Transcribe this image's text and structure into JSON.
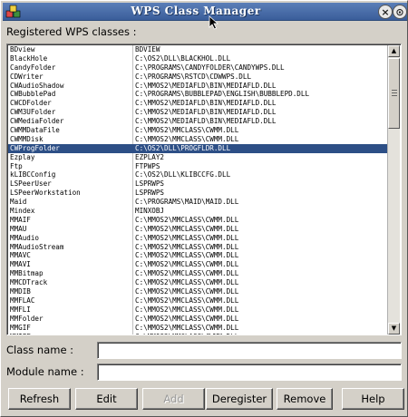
{
  "window": {
    "title": "WPS Class Manager"
  },
  "titlebar": {
    "close_glyph": "×",
    "max_glyph": "⊙"
  },
  "list": {
    "label": "Registered WPS classes :",
    "rows": [
      [
        "BDview",
        "BDVIEW"
      ],
      [
        "BlackHole",
        "C:\\OS2\\DLL\\BLACKHOL.DLL"
      ],
      [
        "CandyFolder",
        "C:\\PROGRAMS\\CANDYFOLDER\\CANDYWPS.DLL"
      ],
      [
        "CDWriter",
        "C:\\PROGRAMS\\RSTCD\\CDWWPS.DLL"
      ],
      [
        "CWAudioShadow",
        "C:\\MMOS2\\MEDIAFLD\\BIN\\MEDIAFLD.DLL"
      ],
      [
        "CWBubblePad",
        "C:\\PROGRAMS\\BUBBLEPAD\\ENGLISH\\BUBBLEPD.DLL"
      ],
      [
        "CWCDFolder",
        "C:\\MMOS2\\MEDIAFLD\\BIN\\MEDIAFLD.DLL"
      ],
      [
        "CWM3UFolder",
        "C:\\MMOS2\\MEDIAFLD\\BIN\\MEDIAFLD.DLL"
      ],
      [
        "CWMediaFolder",
        "C:\\MMOS2\\MEDIAFLD\\BIN\\MEDIAFLD.DLL"
      ],
      [
        "CWMMDataFile",
        "C:\\MMOS2\\MMCLASS\\CWMM.DLL"
      ],
      [
        "CWMMDisk",
        "C:\\MMOS2\\MMCLASS\\CWMM.DLL"
      ],
      [
        "CWProgFolder",
        "C:\\OS2\\DLL\\PROGFLDR.DLL"
      ],
      [
        "Ezplay",
        "EZPLAY2"
      ],
      [
        "Ftp",
        "FTPWPS"
      ],
      [
        "kLIBCConfig",
        "C:\\OS2\\DLL\\KLIBCCFG.DLL"
      ],
      [
        "LSPeerUser",
        "LSPRWPS"
      ],
      [
        "LSPeerWorkstation",
        "LSPRWPS"
      ],
      [
        "Maid",
        "C:\\PROGRAMS\\MAID\\MAID.DLL"
      ],
      [
        "Mindex",
        "MINXOBJ"
      ],
      [
        "MMAIF",
        "C:\\MMOS2\\MMCLASS\\CWMM.DLL"
      ],
      [
        "MMAU",
        "C:\\MMOS2\\MMCLASS\\CWMM.DLL"
      ],
      [
        "MMAudio",
        "C:\\MMOS2\\MMCLASS\\CWMM.DLL"
      ],
      [
        "MMAudioStream",
        "C:\\MMOS2\\MMCLASS\\CWMM.DLL"
      ],
      [
        "MMAVC",
        "C:\\MMOS2\\MMCLASS\\CWMM.DLL"
      ],
      [
        "MMAVI",
        "C:\\MMOS2\\MMCLASS\\CWMM.DLL"
      ],
      [
        "MMBitmap",
        "C:\\MMOS2\\MMCLASS\\CWMM.DLL"
      ],
      [
        "MMCDTrack",
        "C:\\MMOS2\\MMCLASS\\CWMM.DLL"
      ],
      [
        "MMDIB",
        "C:\\MMOS2\\MMCLASS\\CWMM.DLL"
      ],
      [
        "MMFLAC",
        "C:\\MMOS2\\MMCLASS\\CWMM.DLL"
      ],
      [
        "MMFLI",
        "C:\\MMOS2\\MMCLASS\\CWMM.DLL"
      ],
      [
        "MMFolder",
        "C:\\MMOS2\\MMCLASS\\CWMM.DLL"
      ],
      [
        "MMGIF",
        "C:\\MMOS2\\MMCLASS\\CWMM.DLL"
      ],
      [
        "MMIFF",
        "C:\\MMOS2\\MMCLASS\\CWMM.DLL"
      ]
    ],
    "selected_index": 11
  },
  "fields": {
    "class_name_label": "Class name :",
    "class_name_value": "",
    "module_name_label": "Module name :",
    "module_name_value": ""
  },
  "buttons": {
    "refresh": "Refresh",
    "edit": "Edit",
    "add": "Add",
    "deregister": "Deregister",
    "remove": "Remove",
    "help": "Help"
  },
  "colors": {
    "selection": "#2d4f86",
    "titlebar": "#3a5d9a"
  },
  "icons": {
    "system_menu": "wps-cubes-icon",
    "close": "close-icon",
    "maximize": "maximize-icon",
    "cursor": "arrow-cursor-icon"
  }
}
